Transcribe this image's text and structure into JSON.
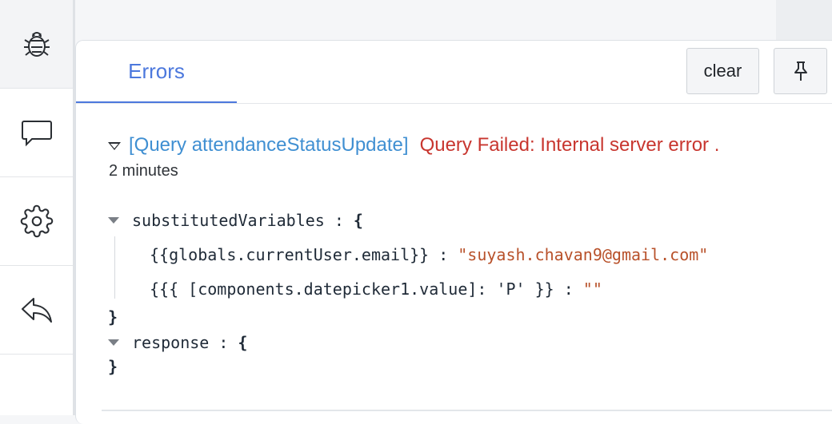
{
  "sidebar": {
    "items": [
      {
        "icon": "bug-icon",
        "name": "debugger"
      },
      {
        "icon": "comment-icon",
        "name": "comments"
      },
      {
        "icon": "gear-icon",
        "name": "settings"
      },
      {
        "icon": "undo-icon",
        "name": "back"
      }
    ]
  },
  "panel": {
    "tab_label": "Errors",
    "clear_label": "clear",
    "pin_icon": "pin-icon"
  },
  "error": {
    "query_label": "[Query attendanceStatusUpdate]",
    "message": "Query Failed: Internal server error .",
    "time": "2 minutes"
  },
  "details": {
    "substituted_key": "substitutedVariables",
    "colon": ":",
    "open_brace": "{",
    "close_brace": "}",
    "var1_key": "{{globals.currentUser.email}}",
    "var1_value": "\"suyash.chavan9@gmail.com\"",
    "var2_key": "{{{ [components.datepicker1.value]: 'P' }}",
    "var2_value": "\"\"",
    "response_key": "response"
  },
  "colors": {
    "accent": "#4c78dd",
    "link": "#3f8fd2",
    "error": "#c8362f",
    "string": "#b8512a"
  }
}
